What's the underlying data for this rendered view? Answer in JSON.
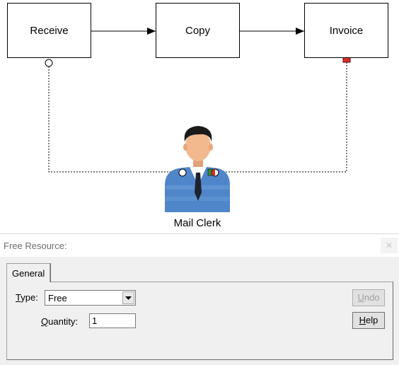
{
  "diagram": {
    "activities": [
      {
        "label": "Receive"
      },
      {
        "label": "Copy"
      },
      {
        "label": "Invoice"
      }
    ],
    "resource": {
      "label": "Mail Clerk"
    }
  },
  "dialog": {
    "title": "Free Resource:",
    "close_glyph": "✕",
    "tabs": [
      {
        "label": "General"
      }
    ],
    "type": {
      "label_first": "T",
      "label_rest": "ype:",
      "value": "Free"
    },
    "quantity": {
      "label_first": "Q",
      "label_rest": "uantity:",
      "value": "1"
    },
    "buttons": {
      "undo": {
        "first": "U",
        "rest": "ndo"
      },
      "help": {
        "first": "H",
        "rest": "elp"
      }
    }
  }
}
